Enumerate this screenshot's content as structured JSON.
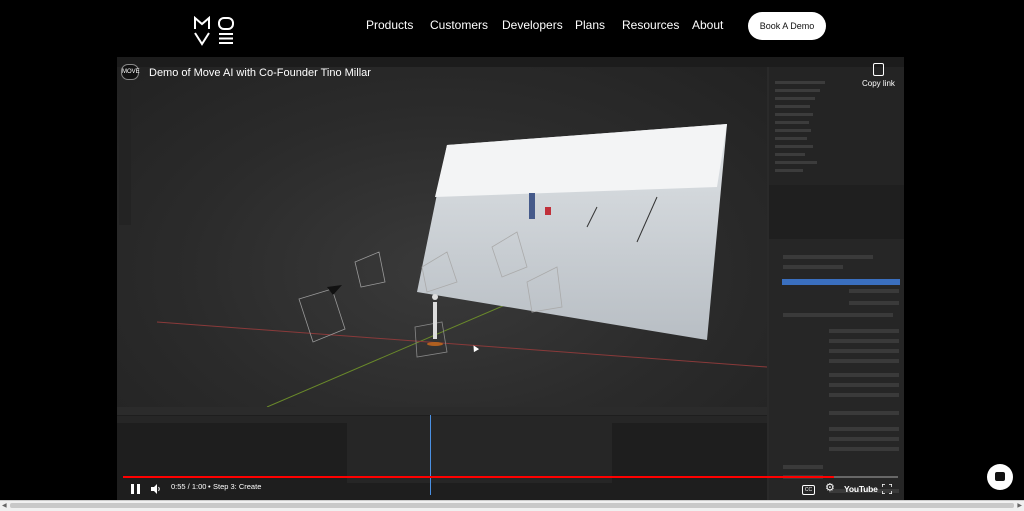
{
  "header": {
    "logo_text": "MOVE",
    "nav": [
      {
        "label": "Products"
      },
      {
        "label": "Customers"
      },
      {
        "label": "Developers"
      },
      {
        "label": "Plans"
      },
      {
        "label": "Resources"
      },
      {
        "label": "About"
      }
    ],
    "cta_label": "Book A Demo"
  },
  "video": {
    "title": "Demo of Move AI with Co-Founder Tino Millar",
    "channel_badge": "MOVE",
    "copy_link_label": "Copy link",
    "time": "0:55 / 1:00",
    "chapter": "Step 3: Create",
    "progress": 0.917,
    "brand": "YouTube",
    "colors": {
      "progress": "#ff0000"
    }
  },
  "icons": [
    "pause-icon",
    "volume-icon",
    "captions-icon",
    "settings-gear-icon",
    "fullscreen-icon",
    "copy-icon",
    "chat-icon"
  ]
}
